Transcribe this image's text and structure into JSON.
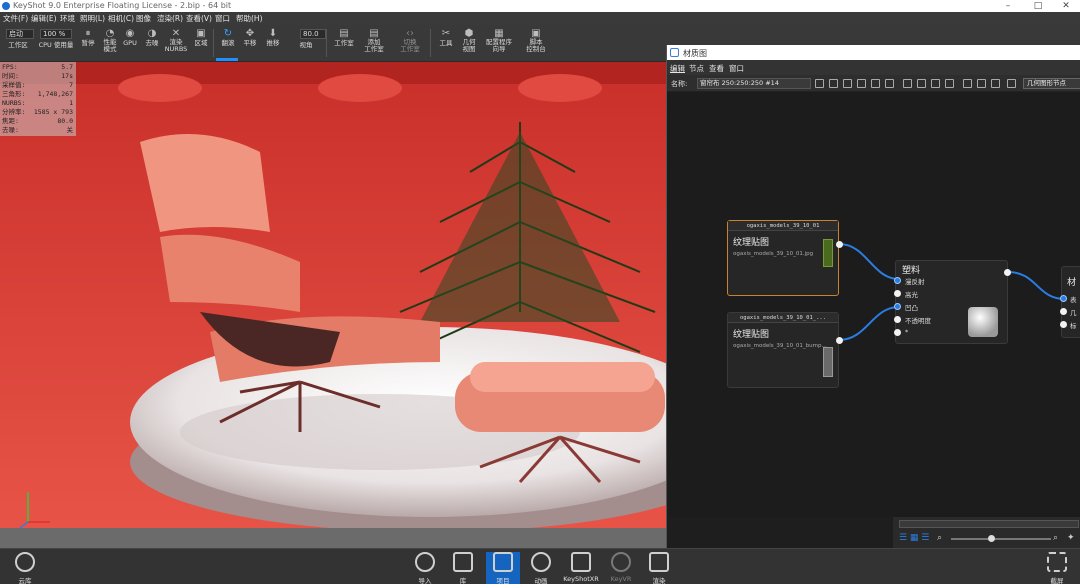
{
  "titlebar": {
    "title": "KeyShot 9.0 Enterprise Floating License  - 2.bip  - 64 bit",
    "min": "–",
    "max": "□",
    "close": "✕"
  },
  "menu": [
    "文件(F)",
    "编辑(E)",
    "环境",
    "照明(L)",
    "相机(C)",
    "图像",
    "渲染(R)",
    "查看(V)",
    "窗口",
    "帮助(H)"
  ],
  "toolbar": {
    "mode_value": "启动",
    "percent_value": "100 %",
    "buttons": {
      "workspace": "工作区",
      "cpu": "CPU 使用量",
      "pause": "暂停",
      "perf": "性能\n模式",
      "gpu": "GPU",
      "denoise": "去噪",
      "render_nurbs": "渲染\nNURBS",
      "region": "区域",
      "tumble": "翻滚",
      "pan": "平移",
      "dolly": "推移",
      "fov": "视角",
      "studio": "工作室",
      "add_studio": "添加\n工作室",
      "switch_studio": "切换\n工作室",
      "tools": "工具",
      "geometry_view": "几何\n视图",
      "config_wizard": "配置程序\n向导",
      "script_console": "脚本\n控制台"
    },
    "angle_value": "80.0"
  },
  "stats": [
    {
      "k": "FPS:",
      "v": "5.7"
    },
    {
      "k": "时间:",
      "v": "17s"
    },
    {
      "k": "采样值:",
      "v": "7"
    },
    {
      "k": "三角形:",
      "v": "1,748,267"
    },
    {
      "k": "NURBS:",
      "v": "1"
    },
    {
      "k": "分辨率:",
      "v": "1585 x 793"
    },
    {
      "k": "焦距:",
      "v": "80.0"
    },
    {
      "k": "去噪:",
      "v": "关"
    }
  ],
  "material_graph": {
    "window_title": "材质图",
    "menu": [
      "编辑",
      "节点",
      "查看",
      "窗口"
    ],
    "name_label": "名称:",
    "name_value": "窗帘布 250:250:250  #14",
    "geometry_button": "几何图形节点",
    "nodes": {
      "tex1": {
        "header": "ogaxis_models_39_10_01",
        "name": "纹理贴图",
        "file": "ogaxis_models_39_10_01.jpg"
      },
      "tex2": {
        "header": "ogaxis_models_39_10_01_...",
        "name": "纹理贴图",
        "file": "ogaxis_models_39_10_01_bump..."
      },
      "plastic": {
        "name": "塑料",
        "ports": [
          "漫反射",
          "高光",
          "凹凸",
          "不透明度",
          "*"
        ]
      },
      "material": {
        "name": "材",
        "ports": [
          "表",
          "几",
          "标"
        ]
      }
    }
  },
  "bottom": {
    "cloud": "云库",
    "import": "导入",
    "library": "库",
    "project": "项目",
    "animation": "动画",
    "keyshotxr": "KeyShotXR",
    "keyvr": "KeyVR",
    "render": "渲染",
    "screenshot": "截屏"
  },
  "colors": {
    "accent": "#1e90ff",
    "wire": "#2a7de1",
    "viewport_bg": "#d8433b"
  }
}
